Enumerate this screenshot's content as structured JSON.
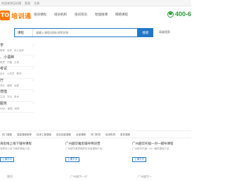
{
  "topbar": {
    "greeting": "欢迎来到培训通",
    "login": "登录",
    "register": "注册"
  },
  "header": {
    "logo_mark": "TO",
    "logo_text": "培训通",
    "nav": [
      "培训课程",
      "培训机构",
      "培训资讯",
      "智能搜课",
      "网络课程"
    ],
    "phone": "400-6"
  },
  "search": {
    "select_value": "课程",
    "placeholder": "请输入课程/机构/讲师名称",
    "button_label": "搜索",
    "advanced_label": "高级搜索"
  },
  "categories": [
    {
      "title": "学",
      "subs": [
        "职称",
        "自考",
        "成人高考"
      ]
    },
    {
      "title": "、小语种",
      "subs": [
        "雅思",
        "托福",
        "日语"
      ]
    },
    {
      "title": "考试",
      "subs": [
        "会计",
        "公务员",
        "教师"
      ]
    },
    {
      "title": "厅",
      "subs": [
        "设计",
        "编程",
        "运营"
      ]
    },
    {
      "title": "增值",
      "subs": [
        "主持",
        "书法",
        "美术"
      ]
    },
    {
      "title": "服务",
      "subs": [
        "MBA",
        "管理",
        "研修"
      ]
    }
  ],
  "filters": [
    "热门课程",
    "智能课程推荐",
    "技术工程课程",
    "岗位技能课程",
    "全部课程",
    "热门机构",
    "培训机构",
    "更多课程"
  ],
  "cards": [
    {
      "title": "海思线上线下辅导课程",
      "desc": "海思线上线下辅导课程介绍",
      "badge": "上课方式"
    },
    {
      "title": "广州越华雅思辅导特训营",
      "desc": "广州越华雅思辅导特训营课程介绍",
      "badge": "上课方式"
    },
    {
      "title": "广州越华托福一对一辅导课程",
      "desc": "广州越华托福一对一辅导课程介绍",
      "badge": "上课方式"
    }
  ],
  "bottom": [
    "雅思",
    "广州越华一对",
    "广州越华一"
  ]
}
